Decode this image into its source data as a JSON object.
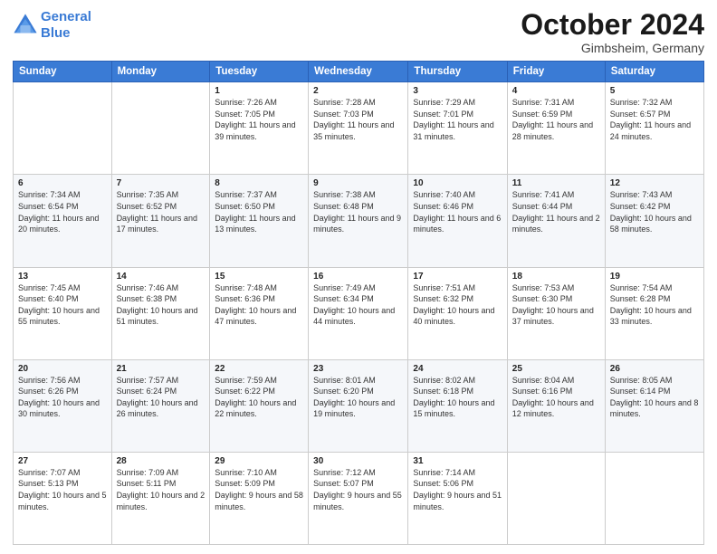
{
  "header": {
    "logo_line1": "General",
    "logo_line2": "Blue",
    "month": "October 2024",
    "location": "Gimbsheim, Germany"
  },
  "weekdays": [
    "Sunday",
    "Monday",
    "Tuesday",
    "Wednesday",
    "Thursday",
    "Friday",
    "Saturday"
  ],
  "weeks": [
    [
      {
        "day": "",
        "sunrise": "",
        "sunset": "",
        "daylight": ""
      },
      {
        "day": "",
        "sunrise": "",
        "sunset": "",
        "daylight": ""
      },
      {
        "day": "1",
        "sunrise": "Sunrise: 7:26 AM",
        "sunset": "Sunset: 7:05 PM",
        "daylight": "Daylight: 11 hours and 39 minutes."
      },
      {
        "day": "2",
        "sunrise": "Sunrise: 7:28 AM",
        "sunset": "Sunset: 7:03 PM",
        "daylight": "Daylight: 11 hours and 35 minutes."
      },
      {
        "day": "3",
        "sunrise": "Sunrise: 7:29 AM",
        "sunset": "Sunset: 7:01 PM",
        "daylight": "Daylight: 11 hours and 31 minutes."
      },
      {
        "day": "4",
        "sunrise": "Sunrise: 7:31 AM",
        "sunset": "Sunset: 6:59 PM",
        "daylight": "Daylight: 11 hours and 28 minutes."
      },
      {
        "day": "5",
        "sunrise": "Sunrise: 7:32 AM",
        "sunset": "Sunset: 6:57 PM",
        "daylight": "Daylight: 11 hours and 24 minutes."
      }
    ],
    [
      {
        "day": "6",
        "sunrise": "Sunrise: 7:34 AM",
        "sunset": "Sunset: 6:54 PM",
        "daylight": "Daylight: 11 hours and 20 minutes."
      },
      {
        "day": "7",
        "sunrise": "Sunrise: 7:35 AM",
        "sunset": "Sunset: 6:52 PM",
        "daylight": "Daylight: 11 hours and 17 minutes."
      },
      {
        "day": "8",
        "sunrise": "Sunrise: 7:37 AM",
        "sunset": "Sunset: 6:50 PM",
        "daylight": "Daylight: 11 hours and 13 minutes."
      },
      {
        "day": "9",
        "sunrise": "Sunrise: 7:38 AM",
        "sunset": "Sunset: 6:48 PM",
        "daylight": "Daylight: 11 hours and 9 minutes."
      },
      {
        "day": "10",
        "sunrise": "Sunrise: 7:40 AM",
        "sunset": "Sunset: 6:46 PM",
        "daylight": "Daylight: 11 hours and 6 minutes."
      },
      {
        "day": "11",
        "sunrise": "Sunrise: 7:41 AM",
        "sunset": "Sunset: 6:44 PM",
        "daylight": "Daylight: 11 hours and 2 minutes."
      },
      {
        "day": "12",
        "sunrise": "Sunrise: 7:43 AM",
        "sunset": "Sunset: 6:42 PM",
        "daylight": "Daylight: 10 hours and 58 minutes."
      }
    ],
    [
      {
        "day": "13",
        "sunrise": "Sunrise: 7:45 AM",
        "sunset": "Sunset: 6:40 PM",
        "daylight": "Daylight: 10 hours and 55 minutes."
      },
      {
        "day": "14",
        "sunrise": "Sunrise: 7:46 AM",
        "sunset": "Sunset: 6:38 PM",
        "daylight": "Daylight: 10 hours and 51 minutes."
      },
      {
        "day": "15",
        "sunrise": "Sunrise: 7:48 AM",
        "sunset": "Sunset: 6:36 PM",
        "daylight": "Daylight: 10 hours and 47 minutes."
      },
      {
        "day": "16",
        "sunrise": "Sunrise: 7:49 AM",
        "sunset": "Sunset: 6:34 PM",
        "daylight": "Daylight: 10 hours and 44 minutes."
      },
      {
        "day": "17",
        "sunrise": "Sunrise: 7:51 AM",
        "sunset": "Sunset: 6:32 PM",
        "daylight": "Daylight: 10 hours and 40 minutes."
      },
      {
        "day": "18",
        "sunrise": "Sunrise: 7:53 AM",
        "sunset": "Sunset: 6:30 PM",
        "daylight": "Daylight: 10 hours and 37 minutes."
      },
      {
        "day": "19",
        "sunrise": "Sunrise: 7:54 AM",
        "sunset": "Sunset: 6:28 PM",
        "daylight": "Daylight: 10 hours and 33 minutes."
      }
    ],
    [
      {
        "day": "20",
        "sunrise": "Sunrise: 7:56 AM",
        "sunset": "Sunset: 6:26 PM",
        "daylight": "Daylight: 10 hours and 30 minutes."
      },
      {
        "day": "21",
        "sunrise": "Sunrise: 7:57 AM",
        "sunset": "Sunset: 6:24 PM",
        "daylight": "Daylight: 10 hours and 26 minutes."
      },
      {
        "day": "22",
        "sunrise": "Sunrise: 7:59 AM",
        "sunset": "Sunset: 6:22 PM",
        "daylight": "Daylight: 10 hours and 22 minutes."
      },
      {
        "day": "23",
        "sunrise": "Sunrise: 8:01 AM",
        "sunset": "Sunset: 6:20 PM",
        "daylight": "Daylight: 10 hours and 19 minutes."
      },
      {
        "day": "24",
        "sunrise": "Sunrise: 8:02 AM",
        "sunset": "Sunset: 6:18 PM",
        "daylight": "Daylight: 10 hours and 15 minutes."
      },
      {
        "day": "25",
        "sunrise": "Sunrise: 8:04 AM",
        "sunset": "Sunset: 6:16 PM",
        "daylight": "Daylight: 10 hours and 12 minutes."
      },
      {
        "day": "26",
        "sunrise": "Sunrise: 8:05 AM",
        "sunset": "Sunset: 6:14 PM",
        "daylight": "Daylight: 10 hours and 8 minutes."
      }
    ],
    [
      {
        "day": "27",
        "sunrise": "Sunrise: 7:07 AM",
        "sunset": "Sunset: 5:13 PM",
        "daylight": "Daylight: 10 hours and 5 minutes."
      },
      {
        "day": "28",
        "sunrise": "Sunrise: 7:09 AM",
        "sunset": "Sunset: 5:11 PM",
        "daylight": "Daylight: 10 hours and 2 minutes."
      },
      {
        "day": "29",
        "sunrise": "Sunrise: 7:10 AM",
        "sunset": "Sunset: 5:09 PM",
        "daylight": "Daylight: 9 hours and 58 minutes."
      },
      {
        "day": "30",
        "sunrise": "Sunrise: 7:12 AM",
        "sunset": "Sunset: 5:07 PM",
        "daylight": "Daylight: 9 hours and 55 minutes."
      },
      {
        "day": "31",
        "sunrise": "Sunrise: 7:14 AM",
        "sunset": "Sunset: 5:06 PM",
        "daylight": "Daylight: 9 hours and 51 minutes."
      },
      {
        "day": "",
        "sunrise": "",
        "sunset": "",
        "daylight": ""
      },
      {
        "day": "",
        "sunrise": "",
        "sunset": "",
        "daylight": ""
      }
    ]
  ]
}
